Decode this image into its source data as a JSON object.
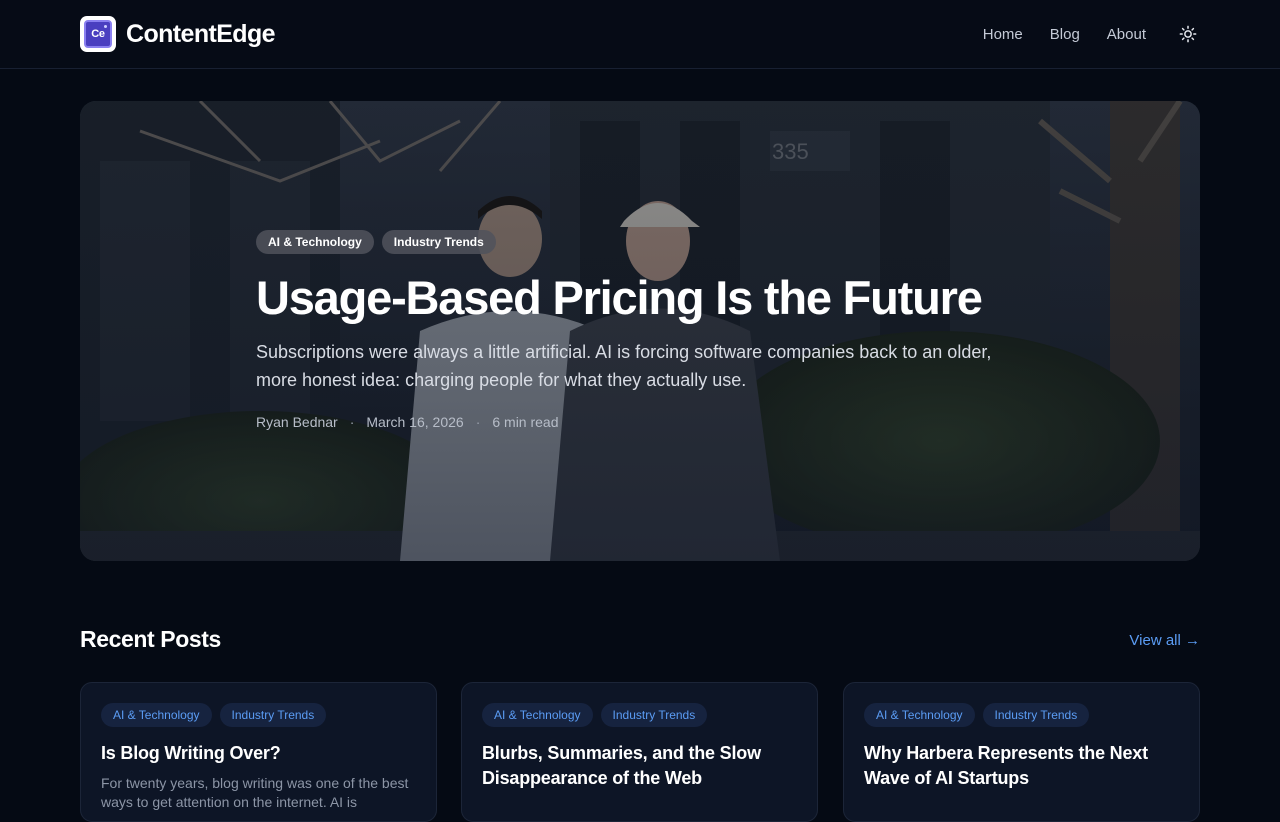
{
  "header": {
    "brand": "ContentEdge",
    "logo_text": "Ce",
    "nav": [
      "Home",
      "Blog",
      "About"
    ],
    "theme_icon": "sun-icon"
  },
  "hero": {
    "tags": [
      "AI & Technology",
      "Industry Trends"
    ],
    "title": "Usage-Based Pricing Is the Future",
    "subtitle": "Subscriptions were always a little artificial. AI is forcing software companies back to an older, more honest idea: charging people for what they actually use.",
    "author": "Ryan Bednar",
    "date": "March 16, 2026",
    "read_time": "6 min read",
    "separator": "·"
  },
  "recent": {
    "title": "Recent Posts",
    "view_all": "View all →",
    "posts": [
      {
        "tags": [
          "AI & Technology",
          "Industry Trends"
        ],
        "title": "Is Blog Writing Over?",
        "excerpt": "For twenty years, blog writing was one of the best ways to get attention on the internet. AI is"
      },
      {
        "tags": [
          "AI & Technology",
          "Industry Trends"
        ],
        "title": "Blurbs, Summaries, and the Slow Disappearance of the Web",
        "excerpt": ""
      },
      {
        "tags": [
          "AI & Technology",
          "Industry Trends"
        ],
        "title": "Why Harbera Represents the Next Wave of AI Startups",
        "excerpt": ""
      }
    ]
  },
  "colors": {
    "background": "#050a14",
    "accent": "#5b9cf4",
    "card": "#0d1526"
  }
}
